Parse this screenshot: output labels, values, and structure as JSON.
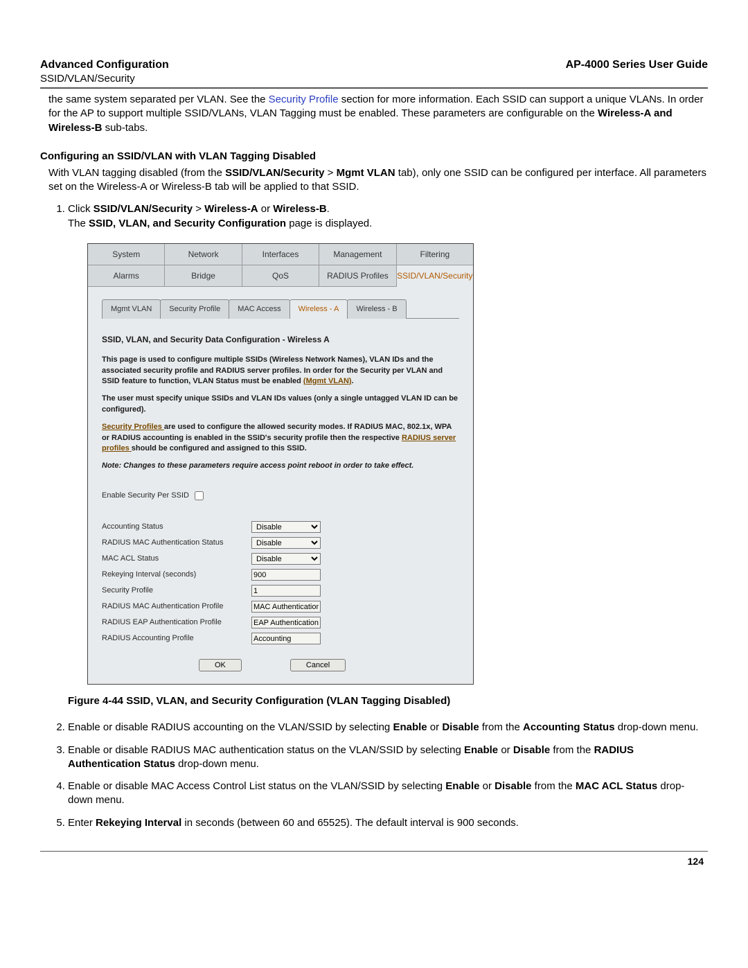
{
  "header": {
    "left": "Advanced Configuration",
    "right": "AP-4000 Series User Guide",
    "sub": "SSID/VLAN/Security"
  },
  "intro": {
    "p1a": "the same system separated per VLAN. See the ",
    "p1link": "Security Profile",
    "p1b": " section for more information. Each SSID can support a unique VLANs. In order for the AP to support multiple SSID/VLANs, VLAN Tagging must be enabled. These parameters are configurable on the ",
    "p1bold": "Wireless-A and Wireless-B",
    "p1c": " sub-tabs."
  },
  "section": {
    "heading": "Configuring an SSID/VLAN with VLAN Tagging Disabled",
    "p1a": "With VLAN tagging disabled (from the ",
    "p1b1": "SSID/VLAN/Security",
    "p1gt": " > ",
    "p1b2": "Mgmt VLAN",
    "p1c": " tab), only one SSID can be configured per interface. All parameters set on the Wireless-A or Wireless-B tab will be applied to that SSID."
  },
  "steps": {
    "s1a": "Click ",
    "s1b1": "SSID/VLAN/Security",
    "s1gt": " > ",
    "s1b2": "Wireless-A",
    "s1or": " or ",
    "s1b3": "Wireless-B",
    "s1end": ".",
    "s1line2a": "The ",
    "s1line2b": "SSID, VLAN, and Security Configuration",
    "s1line2c": " page is displayed.",
    "s2a": "Enable or disable RADIUS accounting on the VLAN/SSID by selecting ",
    "s2b1": "Enable",
    "s2or": " or ",
    "s2b2": "Disable",
    "s2c": " from the ",
    "s2b3": "Accounting Status",
    "s2d": " drop-down menu.",
    "s3a": "Enable or disable RADIUS MAC authentication status on the VLAN/SSID by selecting ",
    "s3b1": "Enable",
    "s3b2": "Disable",
    "s3c": " from the ",
    "s3b3": "RADIUS Authentication Status",
    "s3d": " drop-down menu.",
    "s4a": "Enable or disable MAC Access Control List status on the VLAN/SSID by selecting ",
    "s4b1": "Enable",
    "s4b2": "Disable",
    "s4c": " from the ",
    "s4b3": "MAC ACL Status",
    "s4d": " drop-down menu.",
    "s5a": "Enter ",
    "s5b": "Rekeying Interval",
    "s5c": " in seconds (between 60 and 65525). The default interval is 900 seconds."
  },
  "figure": {
    "caption": "Figure 4-44 SSID, VLAN, and Security Configuration (VLAN Tagging Disabled)",
    "tabs_upper": [
      "System",
      "Network",
      "Interfaces",
      "Management",
      "Filtering"
    ],
    "tabs_lower": [
      "Alarms",
      "Bridge",
      "QoS",
      "RADIUS Profiles",
      "SSID/VLAN/Security"
    ],
    "active_lower": "SSID/VLAN/Security",
    "subtabs": [
      "Mgmt VLAN",
      "Security Profile",
      "MAC Access",
      "Wireless - A",
      "Wireless - B"
    ],
    "active_subtab": "Wireless - A",
    "panel_title": "SSID, VLAN, and Security Data Configuration - Wireless A",
    "para1a": "This page is used to configure multiple SSIDs (Wireless Network Names), VLAN IDs and the associated security profile and RADIUS server profiles. In order for the Security per VLAN and SSID feature to function, VLAN Status must be enabled ",
    "para1link": "(Mgmt VLAN)",
    "para1b": ".",
    "para2": "The user must specify unique SSIDs and VLAN IDs values (only a single untagged VLAN ID can be configured).",
    "para3a_link": "Security Profiles ",
    "para3a": "are used to configure the allowed security modes. If RADIUS MAC, 802.1x, WPA or RADIUS accounting is enabled in the SSID's security profile then the respective ",
    "para3b_link": "RADIUS server profiles ",
    "para3b": "should be configured and assigned to this SSID.",
    "note": "Note: Changes to these parameters require access point reboot in order to take effect.",
    "chk_label": "Enable Security Per SSID",
    "fields": {
      "accounting_status": {
        "label": "Accounting Status",
        "value": "Disable"
      },
      "radius_mac_auth_status": {
        "label": "RADIUS MAC Authentication Status",
        "value": "Disable"
      },
      "mac_acl_status": {
        "label": "MAC ACL Status",
        "value": "Disable"
      },
      "rekeying_interval": {
        "label": "Rekeying Interval (seconds)",
        "value": "900"
      },
      "security_profile": {
        "label": "Security Profile",
        "value": "1"
      },
      "radius_mac_auth_profile": {
        "label": "RADIUS MAC Authentication Profile",
        "value": "MAC Authentication"
      },
      "radius_eap_auth_profile": {
        "label": "RADIUS EAP Authentication Profile",
        "value": "EAP Authentication"
      },
      "radius_accounting_profile": {
        "label": "RADIUS Accounting Profile",
        "value": "Accounting"
      }
    },
    "buttons": {
      "ok": "OK",
      "cancel": "Cancel"
    }
  },
  "page_number": "124"
}
